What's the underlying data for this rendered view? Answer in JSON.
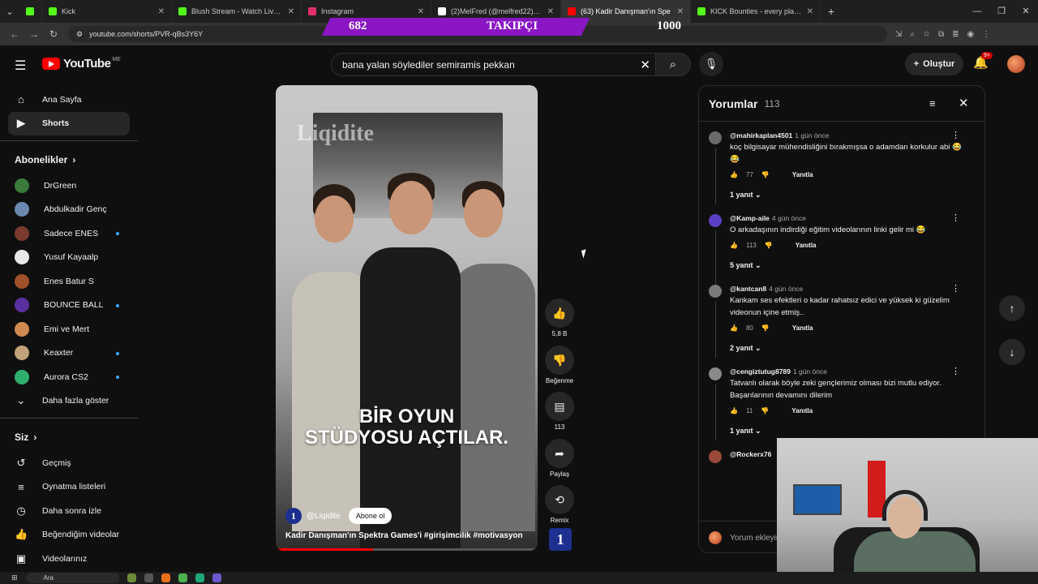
{
  "browser": {
    "tabs": [
      {
        "label": "Kick",
        "color": "#53fc18",
        "active": false
      },
      {
        "label": "Blush Stream - Watch Live on K",
        "color": "#53fc18",
        "active": false
      },
      {
        "label": "Instagram",
        "color": "#e1306c",
        "active": false
      },
      {
        "label": "(2)MelFred (@melfred22) | Tik",
        "color": "#ffffff",
        "active": false
      },
      {
        "label": "(63) Kadir Danışman'ın Spe",
        "color": "#ff0000",
        "active": true
      },
      {
        "label": "KICK Bounties - every player fo",
        "color": "#53fc18",
        "active": false
      }
    ],
    "url": "youtube.com/shorts/PVR-qBs3Y6Y"
  },
  "overlay": {
    "current": "682",
    "label": "TAKIPÇI",
    "goal": "1000"
  },
  "header": {
    "logo": "YouTube",
    "country": "ME",
    "search_value": "bana yalan söylediler semiramis pekkan",
    "create_label": "Oluştur",
    "notif_badge": "9+"
  },
  "sidebar": {
    "main": [
      {
        "label": "Ana Sayfa",
        "icon": "home-icon",
        "glyph": "⌂"
      },
      {
        "label": "Shorts",
        "icon": "shorts-icon",
        "glyph": "▶"
      }
    ],
    "subs_title": "Abonelikler",
    "subs": [
      {
        "label": "DrGreen",
        "color": "#3a7a3a",
        "dot": false
      },
      {
        "label": "Abdulkadir Genç",
        "color": "#6a88b0",
        "dot": false
      },
      {
        "label": "Sadece ENES",
        "color": "#7a3b2e",
        "dot": true
      },
      {
        "label": "Yusuf Kayaalp",
        "color": "#e8e8e8",
        "dot": false
      },
      {
        "label": "Enes Batur S",
        "color": "#a0502a",
        "dot": false
      },
      {
        "label": "BOUNCE BALL",
        "color": "#5a2fa0",
        "dot": true
      },
      {
        "label": "Emi ve Mert",
        "color": "#d08a50",
        "dot": false
      },
      {
        "label": "Keaxter",
        "color": "#c2a27a",
        "dot": true
      },
      {
        "label": "Aurora CS2",
        "color": "#2fae6e",
        "dot": true
      }
    ],
    "show_more": "Daha fazla göster",
    "you_title": "Siz",
    "you": [
      {
        "label": "Geçmiş",
        "icon": "history-icon",
        "glyph": "↺"
      },
      {
        "label": "Oynatma listeleri",
        "icon": "playlist-icon",
        "glyph": "≡"
      },
      {
        "label": "Daha sonra izle",
        "icon": "clock-icon",
        "glyph": "◷"
      },
      {
        "label": "Beğendiğim videolar",
        "icon": "like-icon",
        "glyph": "👍"
      },
      {
        "label": "Videolarınız",
        "icon": "video-icon",
        "glyph": "▣"
      }
    ]
  },
  "short": {
    "brand_watermark": "Liqidite",
    "headline_1": "BİR OYUN",
    "headline_2": "STÜDYOSU AÇTILAR.",
    "channel": "@Liqidite",
    "subscribe": "Abone ol",
    "caption": "Kadir Danışman'ın Spektra Games'i #girişimcilik #motivasyon",
    "progress": 0.37,
    "actions": [
      {
        "label": "5,8 B",
        "icon": "thumbs-up-icon",
        "glyph": "👍"
      },
      {
        "label": "Beğenme",
        "icon": "thumbs-down-icon",
        "glyph": "👎"
      },
      {
        "label": "113",
        "icon": "comment-icon",
        "glyph": "▤"
      },
      {
        "label": "Paylaş",
        "icon": "share-icon",
        "glyph": "➦"
      },
      {
        "label": "Remix",
        "icon": "remix-icon",
        "glyph": "⟲"
      }
    ]
  },
  "comments": {
    "title": "Yorumlar",
    "count": "113",
    "items": [
      {
        "author": "@mahirkaplan4501",
        "time": "1 gün önce",
        "text": "koç bilgisayar mühendisliğini bırakmışsa o adamdan korkulur abi 😂😂",
        "likes": "77",
        "reply_label": "Yanıtla",
        "replies": "1 yanıt",
        "avatar": "#6a6a6a"
      },
      {
        "author": "@Kamp-aile",
        "time": "4 gün önce",
        "text": "O arkadaşının indirdiği eğitim videolarının linki gelir mi 😂",
        "likes": "113",
        "reply_label": "Yanıtla",
        "replies": "5 yanıt",
        "avatar": "#5b3fc4"
      },
      {
        "author": "@kantcan8",
        "time": "4 gün önce",
        "text": "Kankam ses efektleri o kadar rahatsız edici ve yüksek ki güzelim videonun içine etmiş..",
        "likes": "80",
        "reply_label": "Yanıtla",
        "replies": "2 yanıt",
        "avatar": "#7a7a7a"
      },
      {
        "author": "@cengiztutug8789",
        "time": "1 gün önce",
        "text": "Tatvanlı olarak böyle  zeki  gençlerimiz olması bizi mutlu  ediyor. Başarılarının devamını dilerim",
        "likes": "11",
        "reply_label": "Yanıtla",
        "replies": "1 yanıt",
        "avatar": "#8a8a8a"
      },
      {
        "author": "@Rockerx76",
        "time": "",
        "text": "",
        "likes": "",
        "reply_label": "",
        "replies": "",
        "avatar": "#9a4a3a"
      }
    ],
    "input_placeholder": "Yorum ekleyin..."
  },
  "taskbar": {
    "search": "Ara"
  }
}
